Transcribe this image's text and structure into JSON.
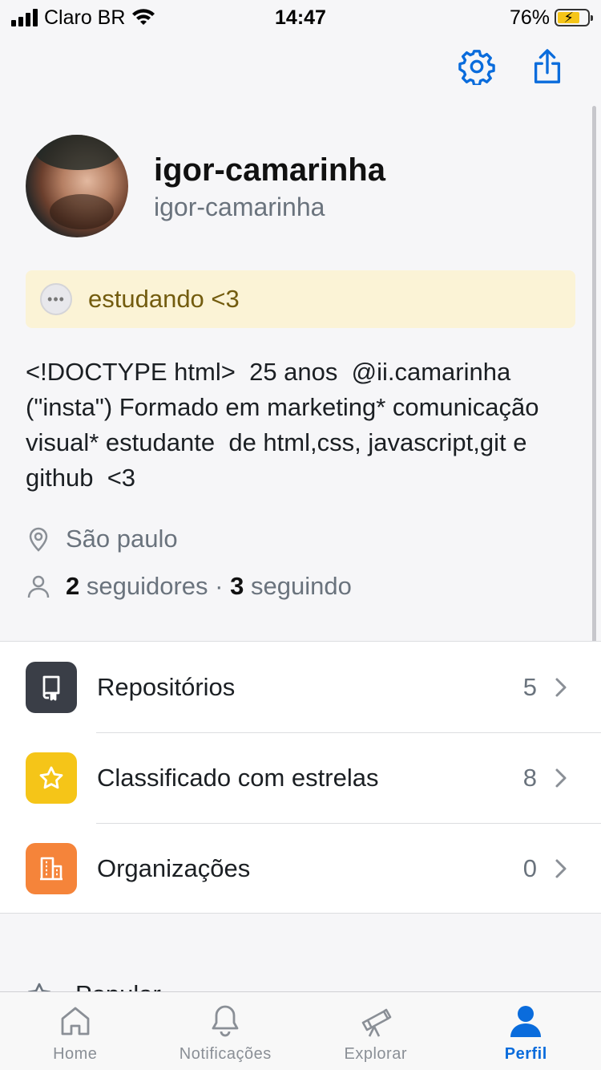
{
  "status_bar": {
    "carrier": "Claro BR",
    "time": "14:47",
    "battery": "76%",
    "battery_level": 0.76
  },
  "profile": {
    "name": "igor-camarinha",
    "login": "igor-camarinha",
    "status": "estudando <3",
    "status_emoji": "speech-balloon",
    "bio": "<!DOCTYPE html>  25 anos  @ii.camarinha (\"insta\") Formado em marketing* comunicação visual* estudante  de html,css, javascript,git e github  <3",
    "location": "São paulo",
    "followers_count": "2",
    "followers_label": "seguidores",
    "separator": "·",
    "following_count": "3",
    "following_label": "seguindo"
  },
  "menu": [
    {
      "label": "Repositórios",
      "count": "5",
      "icon": "repo-icon",
      "color": "#3a3e47"
    },
    {
      "label": "Classificado com estrelas",
      "count": "8",
      "icon": "star-icon",
      "color": "#f5c518"
    },
    {
      "label": "Organizações",
      "count": "0",
      "icon": "organization-icon",
      "color": "#f5843a"
    }
  ],
  "popular_label": "Popular",
  "tabs": [
    {
      "label": "Home",
      "icon": "home-icon"
    },
    {
      "label": "Notificações",
      "icon": "bell-icon"
    },
    {
      "label": "Explorar",
      "icon": "telescope-icon"
    },
    {
      "label": "Perfil",
      "icon": "person-icon",
      "active": true
    }
  ],
  "colors": {
    "accent": "#0a6cdc",
    "status_bg": "#fbf3d6",
    "status_text": "#735c0f"
  }
}
